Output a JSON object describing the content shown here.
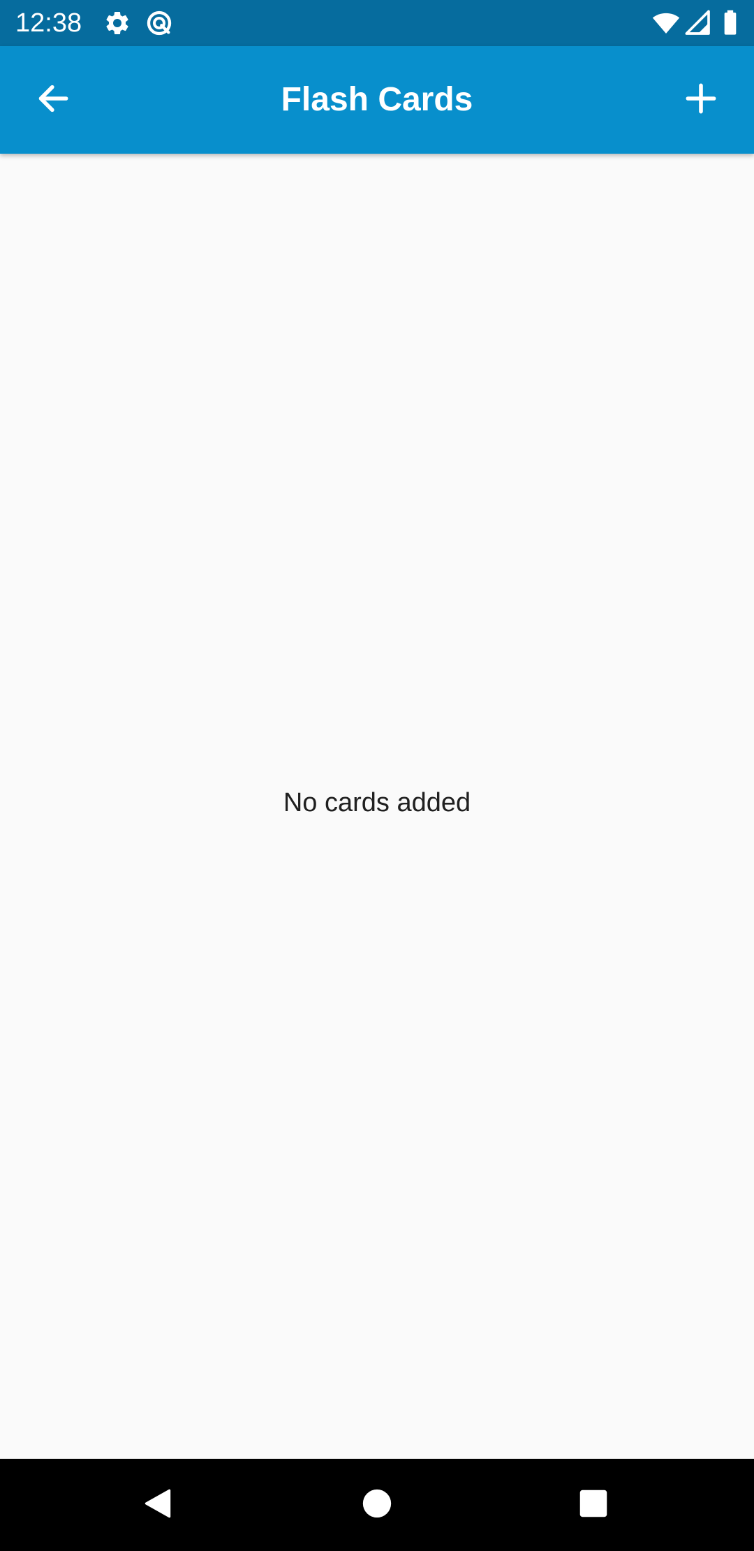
{
  "status_bar": {
    "time": "12:38",
    "icons": [
      "settings-icon",
      "data-saver-icon",
      "wifi-icon",
      "cell-signal-icon",
      "battery-icon"
    ],
    "background": "#066c9e"
  },
  "app_bar": {
    "title": "Flash Cards",
    "back_icon": "arrow-back-icon",
    "add_icon": "plus-icon",
    "background": "#088fcc"
  },
  "content": {
    "empty_message": "No cards added",
    "background": "#fafafa"
  },
  "nav_bar": {
    "buttons": [
      "back-triangle-icon",
      "home-circle-icon",
      "recents-square-icon"
    ],
    "background": "#000000"
  }
}
